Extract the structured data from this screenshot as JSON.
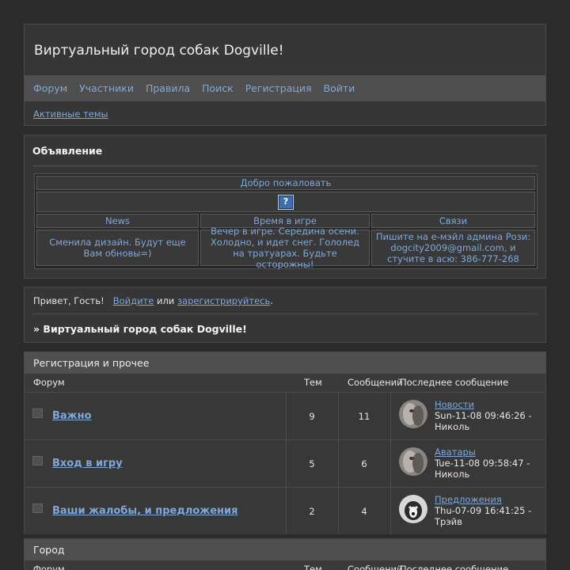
{
  "header": {
    "title": "Виртуальный город собак Dogville!",
    "nav": [
      "Форум",
      "Участники",
      "Правила",
      "Поиск",
      "Регистрация",
      "Войти"
    ],
    "active_topics": "Активные темы"
  },
  "announcement": {
    "heading": "Объявление",
    "welcome": "Добро пожаловать",
    "icon_glyph": "?",
    "columns": [
      "News",
      "Время в игре",
      "Связи"
    ],
    "cells": [
      "Сменила дизайн. Будут еще Вам обновы=)",
      "Вечер в игре. Середина осени. Холодно, и идет снег. Гололед на тратуарах. Будьте осторожны!",
      "Пишите на е-мэйл админа Рози: dogcity2009@gmail.com, и стучите в асю: 386-777-268"
    ]
  },
  "greeting": {
    "hello": "Привет, Гость!",
    "login": "Войдите",
    "or": "или",
    "register": "зарегистрируйтесь",
    "dot": ".",
    "breadcrumb": "» Виртуальный город собак Dogville!"
  },
  "categories": [
    {
      "title": "Регистрация и прочее",
      "headers": {
        "forum": "Форум",
        "topics": "Тем",
        "posts": "Сообщений",
        "last": "Последнее сообщение"
      },
      "rows": [
        {
          "name": "Важно",
          "topics": "9",
          "posts": "11",
          "last_forum": "Новости",
          "last_date": "Sun-11-08 09:46:26 -",
          "last_user": "Николь",
          "avatar": "cat"
        },
        {
          "name": "Вход в игру",
          "topics": "5",
          "posts": "6",
          "last_forum": "Аватары",
          "last_date": "Tue-11-08 09:58:47 -",
          "last_user": "Николь",
          "avatar": "cat"
        },
        {
          "name": "Ваши жалобы, и предложения",
          "topics": "2",
          "posts": "4",
          "last_forum": "Предложения",
          "last_date": "Thu-07-09 16:41:25 -",
          "last_user": "Трэйв",
          "avatar": "dog"
        }
      ]
    },
    {
      "title": "Город",
      "headers": {
        "forum": "Форум",
        "topics": "Тем",
        "posts": "Сообщений",
        "last": "Последнее сообщение"
      }
    }
  ],
  "colors": {
    "background": "#2b2b2b",
    "panel": "#363636",
    "bar": "#4f4f4f",
    "link": "#7fa8d8"
  }
}
